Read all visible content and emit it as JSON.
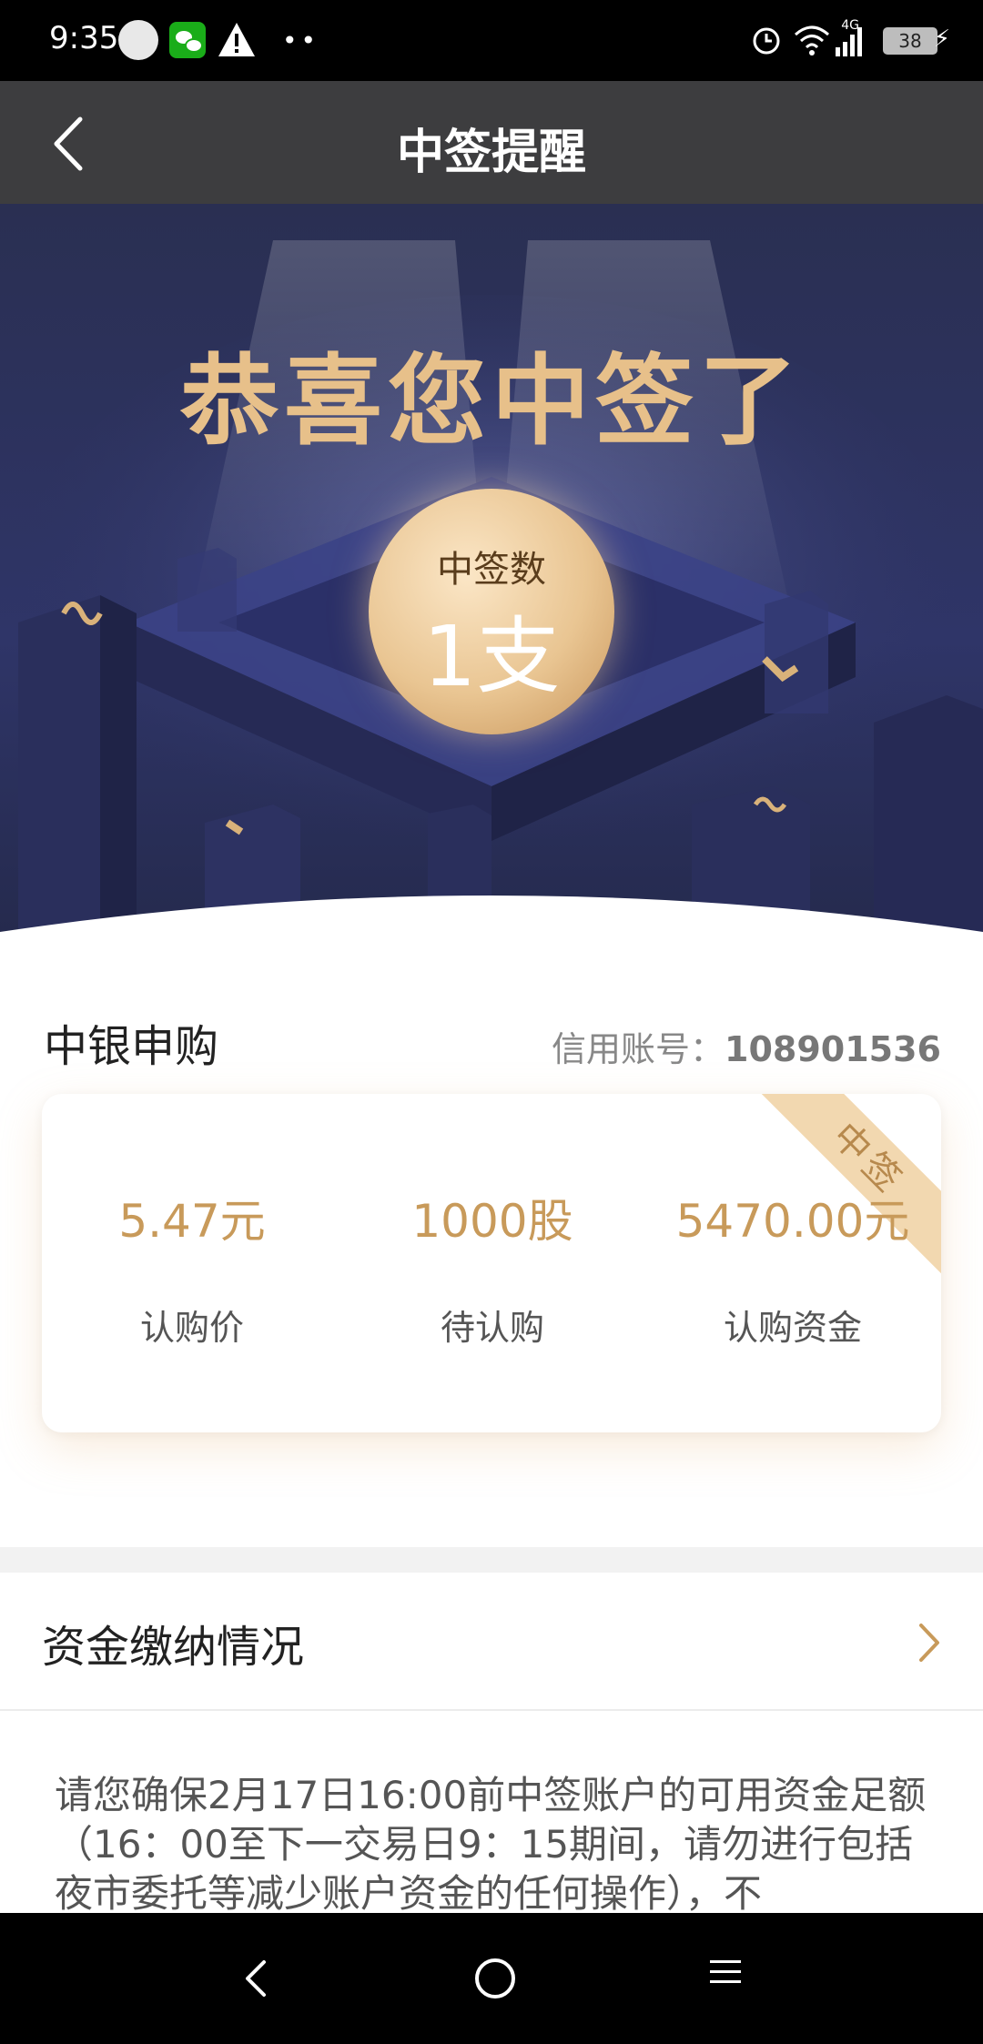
{
  "status_bar": {
    "time": "9:35",
    "network": "4G",
    "battery": "38"
  },
  "nav": {
    "title": "中签提醒"
  },
  "hero": {
    "headline": "恭喜您中签了",
    "medal_label": "中签数",
    "medal_value": "1支"
  },
  "subscription": {
    "broker": "中银申购",
    "account_label": "信用账号：",
    "account_number": "108901536",
    "ribbon": "中签",
    "items": [
      {
        "value": "5.47元",
        "label": "认购价"
      },
      {
        "value": "1000股",
        "label": "待认购"
      },
      {
        "value": "5470.00元",
        "label": "认购资金"
      }
    ]
  },
  "payment": {
    "title": "资金缴纳情况"
  },
  "notice": {
    "text": "请您确保2月17日16:00前中签账户的可用资金足额（16：00至下一交易日9：15期间，请勿进行包括夜市委托等减少账户资金的任何操作），不"
  },
  "colors": {
    "gold": "#c89a5a",
    "nav_bg": "#3d3d3f",
    "hero_bg": "#2b3160"
  }
}
